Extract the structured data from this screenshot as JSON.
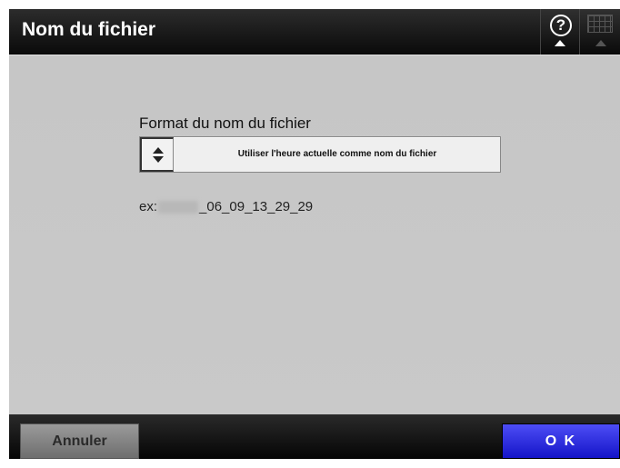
{
  "window": {
    "title": "Nom du fichier"
  },
  "header": {
    "help_glyph": "?",
    "help_icon": "help-icon",
    "keyboard_icon": "keyboard-icon"
  },
  "main": {
    "format_label": "Format du nom du fichier",
    "format_value": "Utiliser l'heure actuelle comme nom du fichier",
    "example_prefix": "ex:",
    "example_suffix": "_06_09_13_29_29"
  },
  "footer": {
    "cancel_label": "Annuler",
    "ok_label": "O K"
  },
  "colors": {
    "ok_button": "#2a2ae0",
    "content_bg": "#c8c8c8",
    "titlebar_bg": "#151515"
  }
}
